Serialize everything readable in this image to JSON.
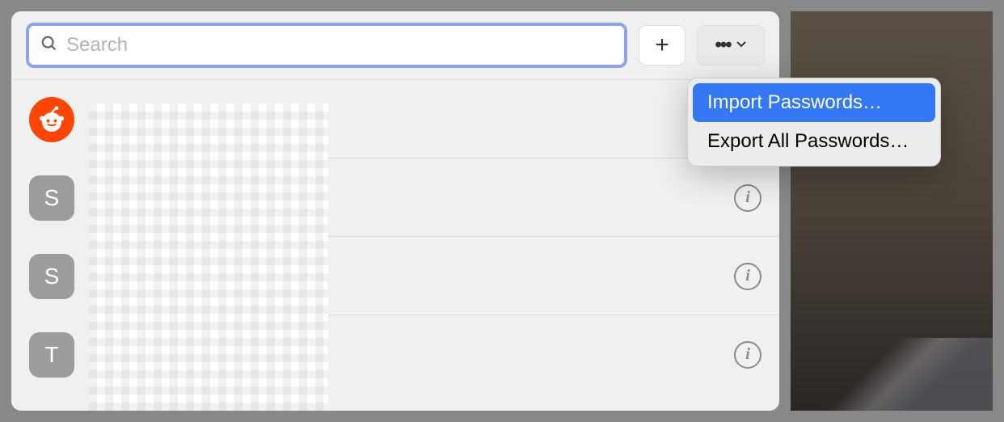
{
  "search": {
    "placeholder": "Search",
    "value": ""
  },
  "entries": [
    {
      "avatar_letter": "",
      "avatar_type": "reddit",
      "show_info": false
    },
    {
      "avatar_letter": "S",
      "avatar_type": "gray",
      "show_info": true
    },
    {
      "avatar_letter": "S",
      "avatar_type": "gray",
      "show_info": true
    },
    {
      "avatar_letter": "T",
      "avatar_type": "gray",
      "show_info": true
    }
  ],
  "buttons": {
    "add_label": "+",
    "more_label": "•••"
  },
  "dropdown": {
    "items": [
      {
        "label": "Import Passwords…",
        "highlighted": true
      },
      {
        "label": "Export All Passwords…",
        "highlighted": false
      }
    ]
  },
  "icons": {
    "info_glyph": "i"
  }
}
